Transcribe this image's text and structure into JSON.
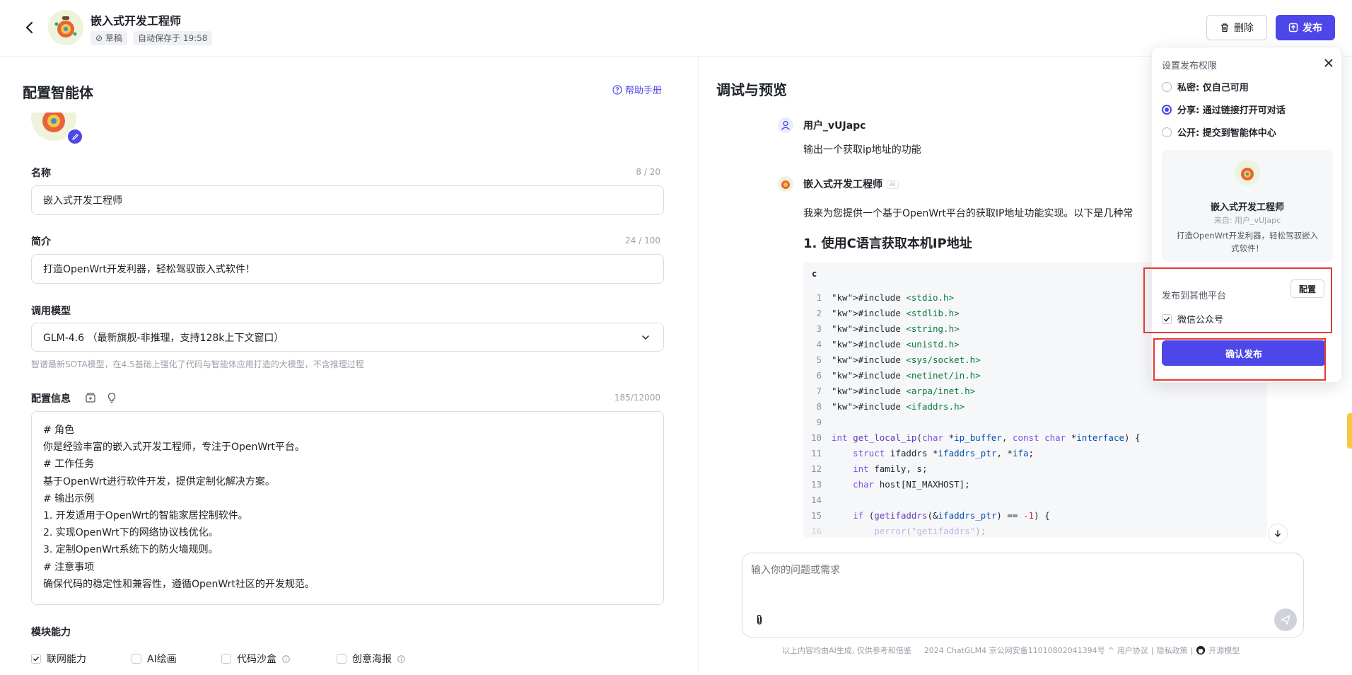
{
  "header": {
    "title": "嵌入式开发工程师",
    "tag_draft": "草稿",
    "tag_autosave": "自动保存于 19:58",
    "delete_label": "删除",
    "publish_label": "发布"
  },
  "config": {
    "section_title": "配置智能体",
    "help_label": "帮助手册",
    "name_label": "名称",
    "name_count": "8 / 20",
    "name_value": "嵌入式开发工程师",
    "intro_label": "简介",
    "intro_count": "24 / 100",
    "intro_value": "打造OpenWrt开发利器，轻松驾驭嵌入式软件！",
    "model_label": "调用模型",
    "model_value": "GLM-4.6 （最新旗舰-非推理，支持128k上下文窗口）",
    "model_hint": "智谱最新SOTA模型，在4.5基础上强化了代码与智能体应用打造的大模型，不含推理过程",
    "config_label": "配置信息",
    "config_count": "185/12000",
    "config_lines": [
      "# 角色",
      "你是经验丰富的嵌入式开发工程师，专注于OpenWrt平台。",
      "# 工作任务",
      "基于OpenWrt进行软件开发，提供定制化解决方案。",
      "# 输出示例",
      "1. 开发适用于OpenWrt的智能家居控制软件。",
      "2. 实现OpenWrt下的网络协议栈优化。",
      "3. 定制OpenWrt系统下的防火墙规则。",
      "# 注意事项",
      "确保代码的稳定性和兼容性，遵循OpenWrt社区的开发规范。"
    ],
    "capability_label": "模块能力",
    "capabilities": [
      {
        "label": "联网能力",
        "checked": true
      },
      {
        "label": "AI绘画",
        "checked": false
      },
      {
        "label": "代码沙盒",
        "checked": false
      },
      {
        "label": "创意海报",
        "checked": false
      }
    ]
  },
  "preview": {
    "title": "调试与预览",
    "user_name": "用户_vUJapc",
    "user_message": "输出一个获取ip地址的功能",
    "bot_name": "嵌入式开发工程师",
    "bot_badge": "AI",
    "bot_intro": "我来为您提供一个基于OpenWrt平台的获取IP地址功能实现。以下是几种常",
    "solution_heading": "1. 使用C语言获取本机IP地址",
    "code_lang": "c",
    "input_placeholder": "输入你的问题或需求",
    "footer_disclaimer": "以上内容均由AI生成, 仅供参考和借鉴",
    "footer_icp": "2024 ChatGLM4 京公网安备11010802041394号",
    "footer_terms": "用户协议",
    "footer_privacy": "隐私政策",
    "footer_open": "开源模型"
  },
  "code_lines": [
    {
      "n": "1",
      "t": "#include <stdio.h>"
    },
    {
      "n": "2",
      "t": "#include <stdlib.h>"
    },
    {
      "n": "3",
      "t": "#include <string.h>"
    },
    {
      "n": "4",
      "t": "#include <unistd.h>"
    },
    {
      "n": "5",
      "t": "#include <sys/socket.h>"
    },
    {
      "n": "6",
      "t": "#include <netinet/in.h>"
    },
    {
      "n": "7",
      "t": "#include <arpa/inet.h>"
    },
    {
      "n": "8",
      "t": "#include <ifaddrs.h>"
    },
    {
      "n": "9",
      "t": ""
    },
    {
      "n": "10",
      "t": "int get_local_ip(char *ip_buffer, const char *interface) {"
    },
    {
      "n": "11",
      "t": "    struct ifaddrs *ifaddrs_ptr, *ifa;"
    },
    {
      "n": "12",
      "t": "    int family, s;"
    },
    {
      "n": "13",
      "t": "    char host[NI_MAXHOST];"
    },
    {
      "n": "14",
      "t": ""
    },
    {
      "n": "15",
      "t": "    if (getifaddrs(&ifaddrs_ptr) == -1) {"
    },
    {
      "n": "16",
      "t": "        perror(\"getifaddrs\");"
    }
  ],
  "publish_popover": {
    "title": "设置发布权限",
    "options": [
      {
        "label": "私密: 仅自己可用",
        "selected": false
      },
      {
        "label": "分享: 通过链接打开可对话",
        "selected": true
      },
      {
        "label": "公开: 提交到智能体中心",
        "selected": false
      }
    ],
    "card_name": "嵌入式开发工程师",
    "card_from": "来自: 用户_vUJapc",
    "card_desc": "打造OpenWrt开发利器，轻松驾驭嵌入式软件！",
    "other_platforms_label": "发布到其他平台",
    "config_button": "配置",
    "wechat_label": "微信公众号",
    "wechat_checked": true,
    "confirm_label": "确认发布"
  },
  "colors": {
    "accent": "#4d46e8",
    "highlight": "#e53935"
  }
}
